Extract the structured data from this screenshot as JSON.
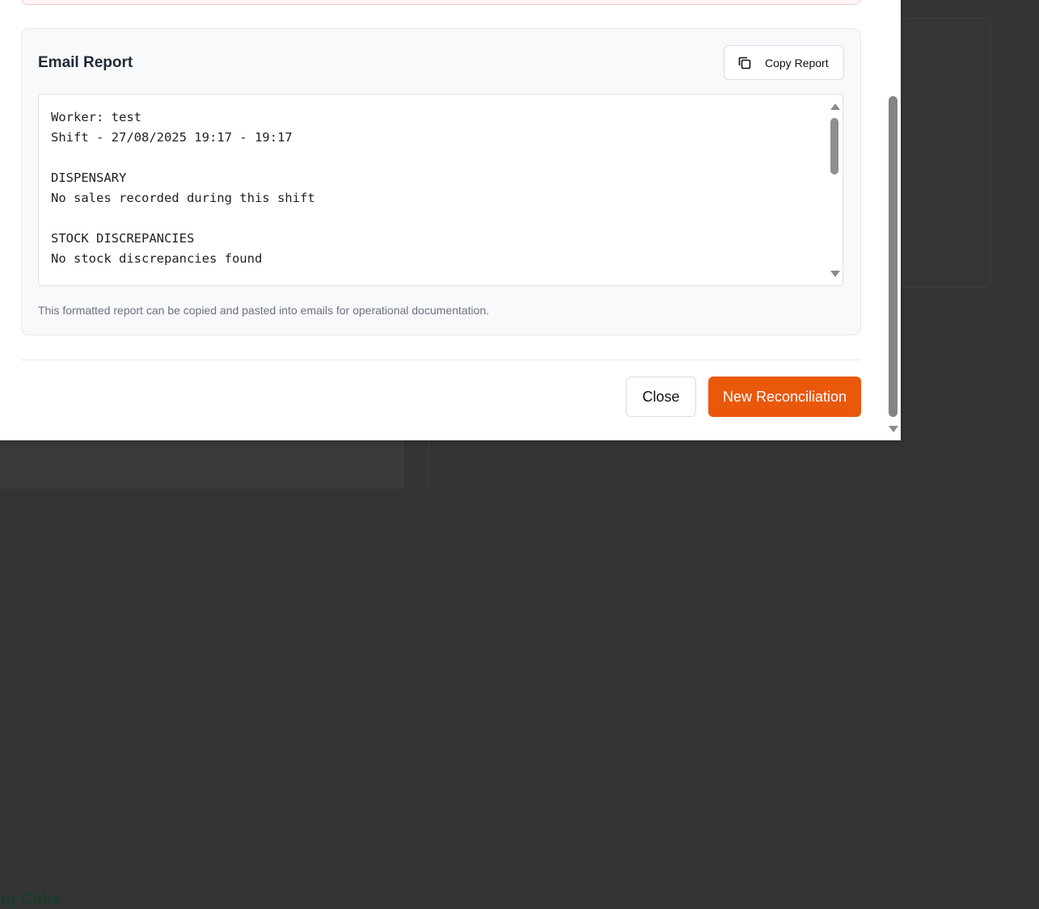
{
  "background": {
    "partial_heading": "ng Cake"
  },
  "email_report": {
    "title": "Email Report",
    "copy_button_label": "Copy Report",
    "report_text": "Worker: test\nShift - 27/08/2025 19:17 - 19:17\n\nDISPENSARY\nNo sales recorded during this shift\n\nSTOCK DISCREPANCIES\nNo stock discrepancies found",
    "note": "This formatted report can be copied and pasted into emails for operational documentation."
  },
  "footer": {
    "close_label": "Close",
    "new_reconciliation_label": "New Reconciliation"
  },
  "colors": {
    "accent": "#ea580c",
    "overlay": "#343434"
  },
  "icons": {
    "copy": "copy-icon"
  }
}
